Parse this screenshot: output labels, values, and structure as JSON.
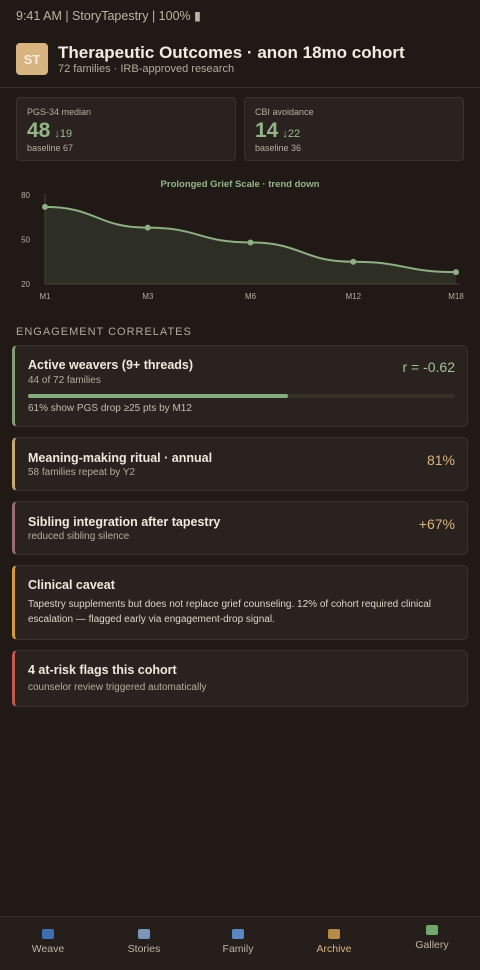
{
  "status_bar": "9:41 AM | StoryTapestry | 100% ▮",
  "header": {
    "avatar": "ST",
    "title": "Therapeutic Outcomes · anon 18mo cohort",
    "subtitle": "72 families · IRB-approved research"
  },
  "stats": [
    {
      "label": "PGS-34 median",
      "value": "48",
      "delta": "↓19",
      "baseline": "baseline 67"
    },
    {
      "label": "CBI avoidance",
      "value": "14",
      "delta": "↓22",
      "baseline": "baseline 36"
    }
  ],
  "chart_data": {
    "type": "line",
    "title": "Prolonged Grief Scale · trend down",
    "categories": [
      "M1",
      "M3",
      "M6",
      "M12",
      "M18"
    ],
    "values": [
      72,
      58,
      48,
      35,
      28
    ],
    "yticks": [
      80,
      50,
      20
    ],
    "ylim": [
      20,
      80
    ],
    "xlabel": "",
    "ylabel": "",
    "grid": false,
    "color": "#8fae84"
  },
  "section_heading": "ENGAGEMENT CORRELATES",
  "cards": {
    "weavers": {
      "title": "Active weavers (9+ threads)",
      "sub": "44 of 72 families",
      "metric": "r = -0.62",
      "progress": 0.61,
      "note": "61% show PGS drop ≥25 pts by M12"
    },
    "ritual": {
      "title": "Meaning-making ritual · annual",
      "sub": "58 families repeat by Y2",
      "metric": "81%"
    },
    "sibling": {
      "title": "Sibling integration after tapestry",
      "sub": "reduced sibling silence",
      "metric": "+67%"
    },
    "caveat": {
      "title": "Clinical caveat",
      "body": "Tapestry supplements but does not replace grief counseling. 12% of cohort required clinical escalation — flagged early via engagement-drop signal."
    },
    "risk": {
      "title": "4 at-risk flags this cohort",
      "sub": "counselor review triggered automatically"
    }
  },
  "nav": [
    {
      "label": "Weave",
      "icon": "spool-icon",
      "color": "#3f6fb0"
    },
    {
      "label": "Stories",
      "icon": "book-icon",
      "color": "#7b95b8"
    },
    {
      "label": "Family",
      "icon": "people-icon",
      "color": "#5b86c4"
    },
    {
      "label": "Archive",
      "icon": "box-icon",
      "color": "#b88a4a",
      "active": true
    },
    {
      "label": "Gallery",
      "icon": "picture-icon",
      "color": "#6fa86a"
    }
  ]
}
